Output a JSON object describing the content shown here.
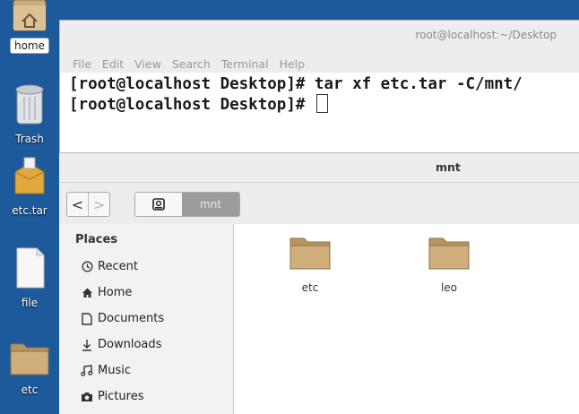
{
  "desktop": {
    "icons": [
      {
        "label": "home"
      },
      {
        "label": "Trash"
      },
      {
        "label": "etc.tar"
      },
      {
        "label": "file"
      },
      {
        "label": "etc"
      }
    ]
  },
  "terminal": {
    "title": "root@localhost:~/Desktop",
    "menu": [
      "File",
      "Edit",
      "View",
      "Search",
      "Terminal",
      "Help"
    ],
    "lines": [
      "[root@localhost Desktop]# tar xf etc.tar -C/mnt/",
      "[root@localhost Desktop]# "
    ]
  },
  "files": {
    "title": "mnt",
    "nav": {
      "back": "<",
      "forward": ">"
    },
    "path_current": "mnt",
    "places_heading": "Places",
    "places": [
      {
        "label": "Recent",
        "icon": "clock-icon"
      },
      {
        "label": "Home",
        "icon": "home-icon"
      },
      {
        "label": "Documents",
        "icon": "document-icon"
      },
      {
        "label": "Downloads",
        "icon": "download-icon"
      },
      {
        "label": "Music",
        "icon": "music-icon"
      },
      {
        "label": "Pictures",
        "icon": "camera-icon"
      }
    ],
    "items": [
      {
        "label": "etc"
      },
      {
        "label": "leo"
      }
    ]
  },
  "colors": {
    "desktop_bg": "#1c5a9c",
    "folder": "#c8a877",
    "path_active": "#9c9c9c"
  }
}
